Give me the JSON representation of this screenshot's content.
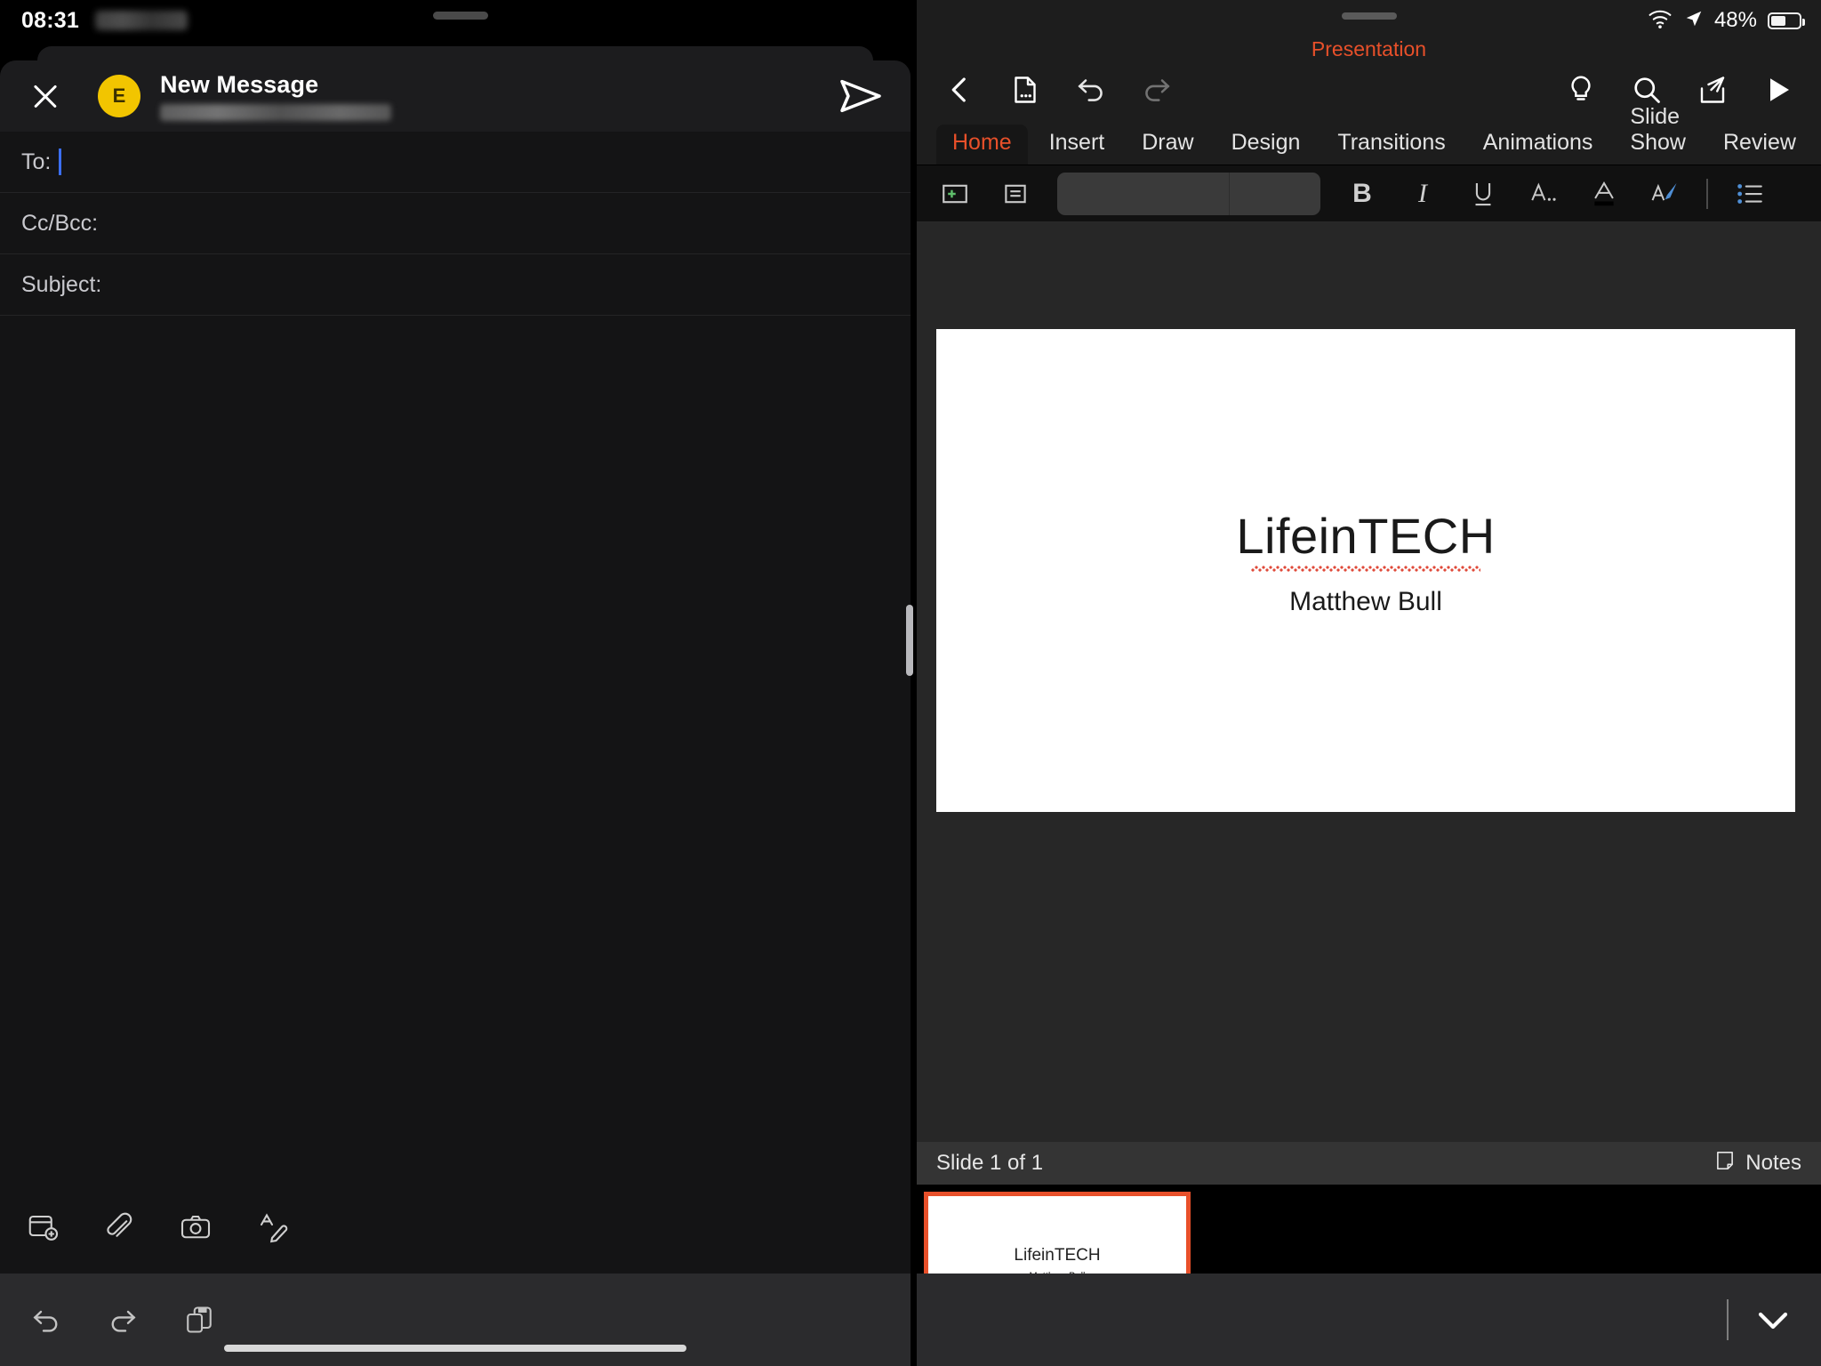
{
  "status_bar_left": {
    "time": "08:31",
    "redacted_label": "(blurred date)"
  },
  "status_bar_right": {
    "wifi_icon": "wifi-icon",
    "location_icon": "location-arrow-icon",
    "battery_percent": "48%",
    "battery_icon": "battery-icon"
  },
  "mail": {
    "close_icon": "close-icon",
    "avatar_initial": "E",
    "title": "New Message",
    "account_email_redacted": "(blurred account email)",
    "send_icon": "send-icon",
    "fields": [
      {
        "label": "To:",
        "value": "",
        "focused": true
      },
      {
        "label": "Cc/Bcc:",
        "value": "",
        "focused": false
      },
      {
        "label": "Subject:",
        "value": "",
        "focused": false
      }
    ],
    "body": "",
    "attach_toolbar": [
      {
        "name": "add-calendar-icon",
        "label": "Add Calendar Event"
      },
      {
        "name": "paperclip-icon",
        "label": "Attach File"
      },
      {
        "name": "camera-icon",
        "label": "Take Photo"
      },
      {
        "name": "markup-icon",
        "label": "Markup"
      }
    ],
    "edit_toolbar": [
      {
        "name": "undo-icon",
        "label": "Undo"
      },
      {
        "name": "redo-icon",
        "label": "Redo"
      },
      {
        "name": "paste-icon",
        "label": "Paste"
      }
    ]
  },
  "powerpoint": {
    "document_title": "Presentation",
    "top_toolbar": [
      {
        "name": "back-icon",
        "label": "Back"
      },
      {
        "name": "file-options-icon",
        "label": "File"
      },
      {
        "name": "undo-icon",
        "label": "Undo"
      },
      {
        "name": "redo-icon",
        "label": "Redo"
      }
    ],
    "top_toolbar_right": [
      {
        "name": "lightbulb-icon",
        "label": "Tell Me"
      },
      {
        "name": "search-icon",
        "label": "Search"
      },
      {
        "name": "share-icon",
        "label": "Share"
      },
      {
        "name": "play-icon",
        "label": "Present"
      }
    ],
    "tabs": [
      {
        "label": "Home",
        "active": true
      },
      {
        "label": "Insert",
        "active": false
      },
      {
        "label": "Draw",
        "active": false
      },
      {
        "label": "Design",
        "active": false
      },
      {
        "label": "Transitions",
        "active": false
      },
      {
        "label": "Animations",
        "active": false
      },
      {
        "label": "Slide Show",
        "active": false
      },
      {
        "label": "Review",
        "active": false
      }
    ],
    "format_bar": [
      {
        "name": "new-slide-icon",
        "label": "New Slide"
      },
      {
        "name": "layout-icon",
        "label": "Layout"
      },
      {
        "name": "font-selector",
        "label": "Font and Size"
      },
      {
        "name": "bold-button",
        "label": "B"
      },
      {
        "name": "italic-button",
        "label": "I"
      },
      {
        "name": "underline-button",
        "label": "U"
      },
      {
        "name": "more-font-formats-button",
        "label": "A"
      },
      {
        "name": "font-color-button",
        "label": "A"
      },
      {
        "name": "format-painter-button",
        "label": "A"
      },
      {
        "name": "bullet-list-button",
        "label": "Bullets"
      }
    ],
    "slide": {
      "title": "LifeinTECH",
      "subtitle": "Matthew Bull",
      "title_misspelled": true
    },
    "status": {
      "slide_counter": "Slide 1 of 1",
      "notes_label": "Notes",
      "notes_icon": "notes-icon"
    },
    "thumbnails": [
      {
        "title": "LifeinTECH",
        "subtitle": "Matthew Bull",
        "selected": true
      }
    ],
    "keyboard_bar": {
      "collapse_icon": "chevron-down-icon"
    },
    "accent_color": "#e8502a",
    "selection_color": "#e8502a"
  }
}
